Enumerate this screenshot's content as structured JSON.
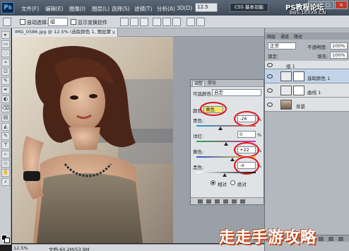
{
  "menubar": {
    "logo": "Ps",
    "items": [
      "文件(F)",
      "编辑(E)",
      "图像(I)",
      "图层(L)",
      "选择(S)",
      "滤镜(T)",
      "分析(A)",
      "3D(D)"
    ],
    "zoom": "12.5",
    "workspace_badge": "CS5 基本功能",
    "window_controls": [
      "_",
      "□",
      "×"
    ]
  },
  "watermarks": {
    "top": "PS教程论坛",
    "top_url": "BBS.16XX8.CN",
    "bottom": "走走手游攻略"
  },
  "options_bar": {
    "auto_select": "自动选择:",
    "layer_select": "组",
    "show_transform": "显示变换控件"
  },
  "tools": [
    "▸",
    "▭",
    "◌",
    "⌖",
    "⊡",
    "✎",
    "✒",
    "◐",
    "⌫",
    "▤",
    "◭",
    "✎",
    "T",
    "▹",
    "◇",
    "✋",
    "⌕"
  ],
  "document": {
    "tab_title": "IMG_0586.jpg @ 12.5% (选取颜色 1, 图层蒙版/8) *",
    "tab_close": "×",
    "status_zoom": "12.5%",
    "status_doc": "文档:60.2M/53.9M"
  },
  "adjustments": {
    "tabs": [
      "调整",
      "蒙版"
    ],
    "title": "可选颜色",
    "preset": "自定",
    "colors_label": "颜色:",
    "colors_value": "黄色",
    "fields": [
      {
        "label": "青色:",
        "value": "-26",
        "pct": "%"
      },
      {
        "label": "洋红:",
        "value": "0",
        "pct": "%"
      },
      {
        "label": "黄色:",
        "value": "+22",
        "pct": "%"
      },
      {
        "label": "黑色:",
        "value": "-4",
        "pct": "%"
      }
    ],
    "method_relative": "相对",
    "method_absolute": "绝对",
    "method_selected": "relative"
  },
  "layers": {
    "tabs": [
      "图层",
      "通道",
      "路径"
    ],
    "blend_mode": "正常",
    "opacity_label": "不透明度:",
    "opacity_value": "100%",
    "lock_label": "锁定:",
    "fill_label": "填充:",
    "fill_value": "100%",
    "items": [
      {
        "name": "组 1",
        "type": "group"
      },
      {
        "name": "选取颜色 1",
        "type": "adjustment"
      },
      {
        "name": "曲线 1",
        "type": "adjustment"
      },
      {
        "name": "背景",
        "type": "image"
      }
    ]
  },
  "colors": {
    "highlight_oval": "#e0101a",
    "selected_layer": "#c2d4ea"
  }
}
